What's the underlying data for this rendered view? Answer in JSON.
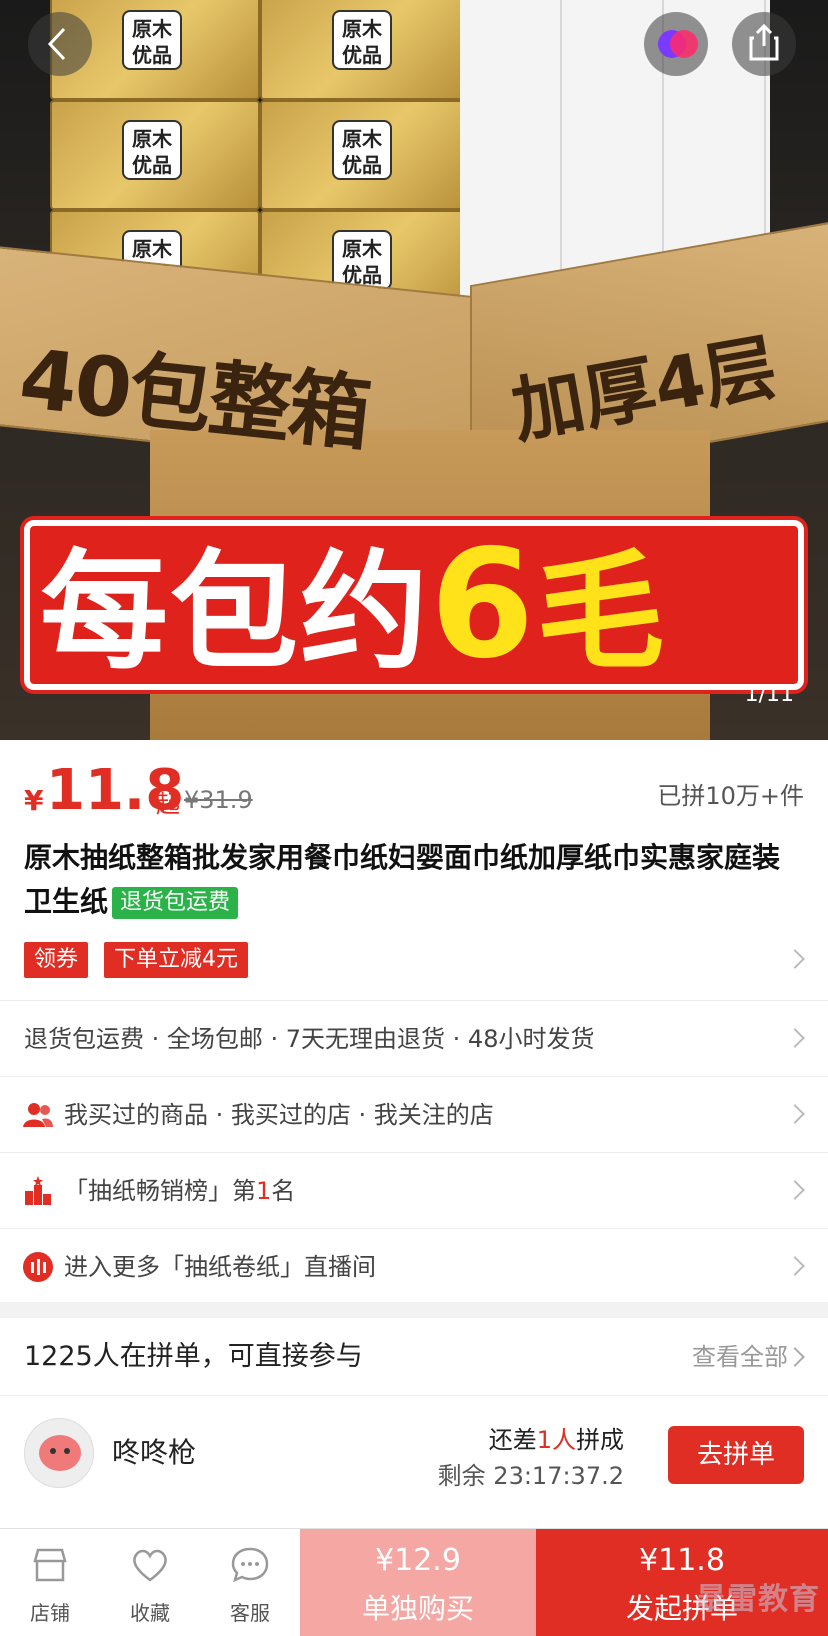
{
  "hero": {
    "pack_label": "原木优品",
    "box_text_left": "40包整箱",
    "box_text_right": "加厚4层",
    "banner_main": "每包约",
    "banner_six": "6",
    "banner_mao": "毛",
    "pager": "1/11"
  },
  "price": {
    "currency": "¥",
    "value": "11.8",
    "suffix": "起",
    "original": "¥31.9",
    "sold": "已拼10万+件"
  },
  "product": {
    "title": "原木抽纸整箱批发家用餐巾纸妇婴面巾纸加厚纸巾实惠家庭装卫生纸",
    "tag": "退货包运费"
  },
  "coupons": {
    "coupon1": "领券",
    "coupon2": "下单立减4元"
  },
  "rows": {
    "services": "退货包运费 · 全场包邮 · 7天无理由退货 · 48小时发货",
    "history": "我买过的商品 · 我买过的店 · 我关注的店",
    "rank_prefix": "「抽纸畅销榜」第",
    "rank_num": "1",
    "rank_suffix": "名",
    "live": "进入更多「抽纸卷纸」直播间"
  },
  "group": {
    "header": "1225人在拼单，可直接参与",
    "view_all": "查看全部",
    "user": "咚咚枪",
    "need_prefix": "还差",
    "need_num": "1人",
    "need_suffix": "拼成",
    "remain": "剩余 23:17:37.2",
    "join": "去拼单"
  },
  "bottom": {
    "store": "店铺",
    "fav": "收藏",
    "service": "客服",
    "alone_price": "¥12.9",
    "alone_label": "单独购买",
    "group_price": "¥11.8",
    "group_label": "发起拼单"
  },
  "watermark": "暴雷教育",
  "colors": {
    "accent": "#e02e24",
    "green_tag": "#2bb34a",
    "alone_btn": "#f4a7a3"
  }
}
